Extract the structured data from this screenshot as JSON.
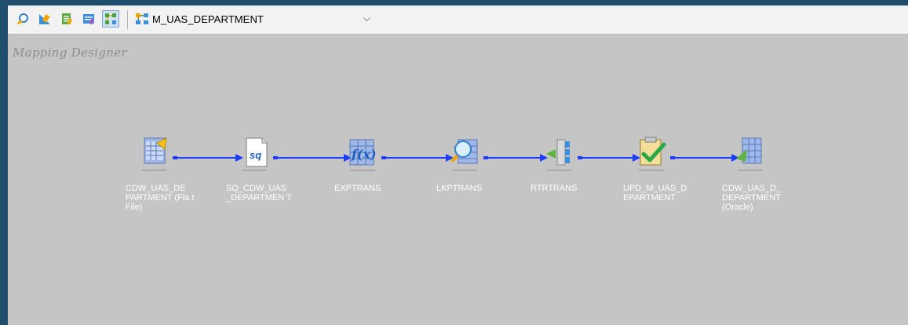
{
  "toolbar": {
    "buttons": [
      {
        "name": "transformation-icon"
      },
      {
        "name": "source-analyzer-icon"
      },
      {
        "name": "target-designer-icon"
      },
      {
        "name": "mapplet-designer-icon"
      },
      {
        "name": "mapping-designer-icon"
      }
    ],
    "mapping_name": "M_UAS_DEPARTMENT"
  },
  "canvas": {
    "title": "Mapping Designer",
    "nodes": [
      {
        "id": "src",
        "label": "CDW_UAS_DE PARTMENT (Fla t File)",
        "icon": "flat-file-source-icon"
      },
      {
        "id": "sq",
        "label": "SQ_CDW_UAS _DEPARTMEN T",
        "icon": "source-qualifier-icon"
      },
      {
        "id": "exp",
        "label": "EXPTRANS",
        "icon": "expression-icon"
      },
      {
        "id": "lkp",
        "label": "LKPTRANS",
        "icon": "lookup-icon"
      },
      {
        "id": "rtr",
        "label": "RTRTRANS",
        "icon": "router-icon"
      },
      {
        "id": "upd",
        "label": "UPD_M_UAS_D EPARTMENT",
        "icon": "update-strategy-icon"
      },
      {
        "id": "tgt",
        "label": "CDW_UAS_D_ DEPARTMENT (Oracle)",
        "icon": "oracle-target-icon"
      }
    ]
  },
  "colors": {
    "frame": "#1f4e6e",
    "canvas": "#c5c5c5",
    "connector": "#1e3cff",
    "label": "#ffffff"
  }
}
